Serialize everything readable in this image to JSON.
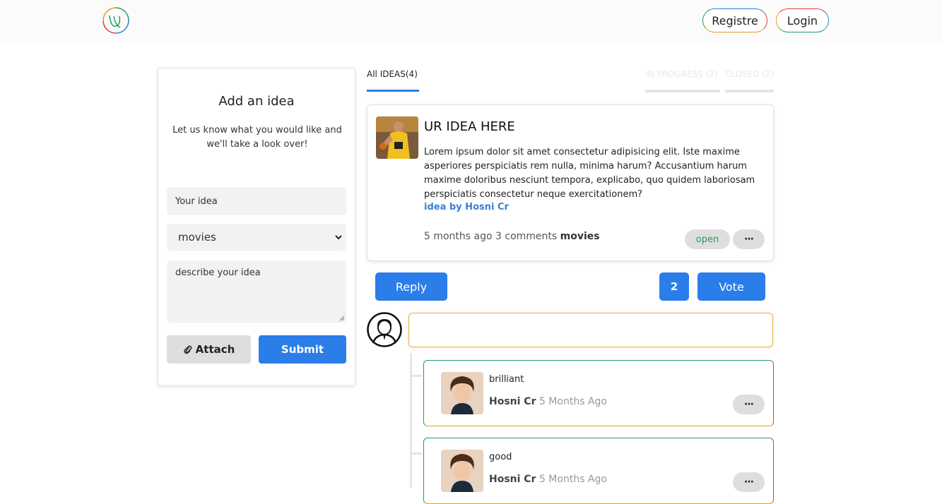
{
  "header": {
    "logo_icon": "swirl-logo-icon",
    "register_label": "Registre",
    "login_label": "Login"
  },
  "add_idea": {
    "title": "Add an idea",
    "subtitle": "Let us know what you would like and we'll take a look over!",
    "idea_placeholder": "Your idea",
    "category_selected": "movies",
    "description_placeholder": "describe your idea",
    "attach_label": "Attach",
    "submit_label": "Submit"
  },
  "tabs": {
    "all": "All IDEAS(4)",
    "in_progress": "IN PROGRESS (2)",
    "closed": "CLOSED (2)"
  },
  "idea": {
    "title": "UR IDEA HERE",
    "body": "Lorem ipsum dolor sit amet consectetur adipisicing elit. Iste maxime asperiores perspiciatis rem nulla, minima harum? Accusantium harum maxime doloribus nesciunt tempora, explicabo, quo quidem laboriosam perspiciatis consectetur neque exercitationem?",
    "author": "idea by Hosni Cr",
    "time": "5 months ago",
    "comments": "3 comments",
    "category": "movies",
    "status": "open",
    "more": "···"
  },
  "actions": {
    "reply_label": "Reply",
    "vote_count": "2",
    "vote_label": "Vote"
  },
  "comments": [
    {
      "text": "brilliant",
      "author": "Hosni Cr",
      "time": "5 Months Ago",
      "more": "···"
    },
    {
      "text": "good",
      "author": "Hosni Cr",
      "time": "5 Months Ago",
      "more": "···"
    }
  ],
  "colors": {
    "accent": "#2b7de9",
    "open_status": "#2a9a55",
    "reply_border": "#e8b33a"
  }
}
